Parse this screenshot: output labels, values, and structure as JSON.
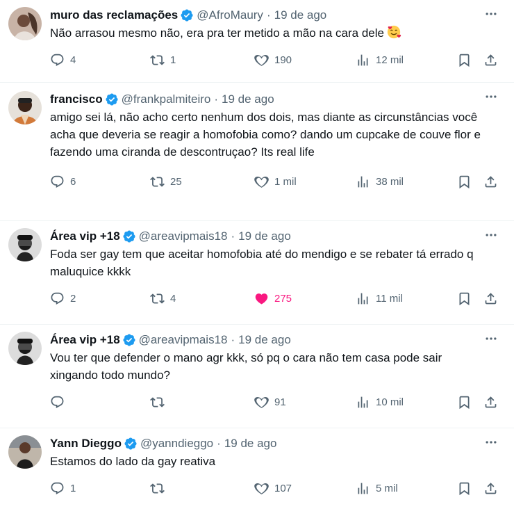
{
  "tweets": [
    {
      "name": "muro das reclamações",
      "handle": "@AfroMaury",
      "dot": "·",
      "date": "19 de ago",
      "text": "Não arrasou mesmo não, era pra ter metido a mão na cara dele",
      "emoji": "smiling-face-with-hearts",
      "replies": "4",
      "retweets": "1",
      "likes": "190",
      "views": "12 mil",
      "liked": false,
      "avatar_color": "#b89a86"
    },
    {
      "name": "francisco",
      "handle": "@frankpalmiteiro",
      "dot": "·",
      "date": "19 de ago",
      "text": "amigo sei lá, não acho certo nenhum dos dois, mas diante as circunstâncias você acha que deveria se reagir a homofobia como? dando um cupcake de couve flor e fazendo uma ciranda de descontruçao? Its real life",
      "replies": "6",
      "retweets": "25",
      "likes": "1 mil",
      "views": "38 mil",
      "liked": false,
      "avatar_color": "#d9b89a"
    },
    {
      "name": "Área vip +18",
      "handle": "@areavipmais18",
      "dot": "·",
      "date": "19 de ago",
      "text": "Foda ser gay tem que aceitar homofobia até do mendigo e se rebater tá errado q maluquice kkkk",
      "replies": "2",
      "retweets": "4",
      "likes": "275",
      "views": "11 mil",
      "liked": true,
      "avatar_color": "#d7d7d7"
    },
    {
      "name": "Área vip +18",
      "handle": "@areavipmais18",
      "dot": "·",
      "date": "19 de ago",
      "text": "Vou ter que defender o mano agr kkk, só pq o cara não tem casa pode sair xingando todo mundo?",
      "replies": "",
      "retweets": "",
      "likes": "91",
      "views": "10 mil",
      "liked": false,
      "avatar_color": "#d7d7d7"
    },
    {
      "name": "Yann Dieggo",
      "handle": "@yanndieggo",
      "dot": "·",
      "date": "19 de ago",
      "text": "Estamos do lado da gay reativa",
      "replies": "1",
      "retweets": "",
      "likes": "107",
      "views": "5 mil",
      "liked": false,
      "avatar_color": "#c9c2b8"
    }
  ],
  "colors": {
    "verified": "#1d9bf0",
    "muted": "#536471",
    "like": "#f91880",
    "border": "#eff3f4"
  },
  "icons": [
    "reply-icon",
    "retweet-icon",
    "like-icon",
    "views-icon",
    "bookmark-icon",
    "share-icon",
    "more-icon",
    "verified-badge-icon"
  ]
}
